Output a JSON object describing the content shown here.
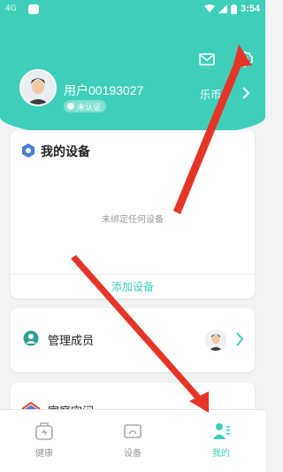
{
  "status_bar": {
    "carrier": "4G",
    "time": "3:54"
  },
  "header": {
    "username": "用户00193027",
    "cert_status": "未认证",
    "coins_label": "乐币",
    "icons": [
      "mail-icon",
      "gear-icon"
    ]
  },
  "device_card": {
    "title": "我的设备",
    "empty_text": "未绑定任何设备",
    "add_label": "添加设备"
  },
  "members_card": {
    "label": "管理成员"
  },
  "home_card": {
    "label": "家庭空间"
  },
  "tabs": [
    {
      "label": "健康",
      "icon": "health-icon"
    },
    {
      "label": "设备",
      "icon": "device-tab-icon"
    },
    {
      "label": "我的",
      "icon": "profile-icon",
      "active": true
    }
  ],
  "colors": {
    "accent": "#3ecfb9",
    "arrow": "#e53528"
  }
}
